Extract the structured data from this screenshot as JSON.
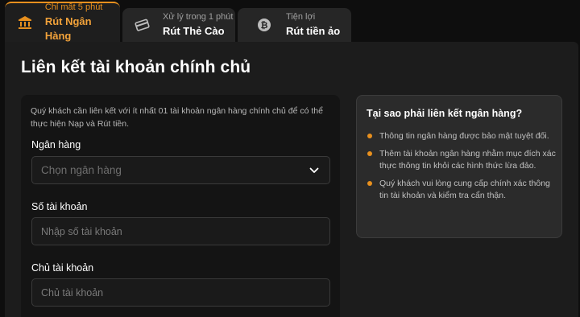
{
  "tabs": [
    {
      "sub": "Chỉ mất 5 phút",
      "main": "Rút Ngân Hàng",
      "icon": "bank-icon",
      "active": true
    },
    {
      "sub": "Xử lý trong 1 phút",
      "main": "Rút Thẻ Cào",
      "icon": "card-icon",
      "active": false
    },
    {
      "sub": "Tiện lợi",
      "main": "Rút tiền ảo",
      "icon": "bitcoin-icon",
      "active": false
    }
  ],
  "page_title": "Liên kết tài khoản chính chủ",
  "form": {
    "intro": "Quý khách cần liên kết với ít nhất 01 tài khoản ngân hàng chính chủ để có thể thực hiện Nạp và Rút tiền.",
    "bank_label": "Ngân hàng",
    "bank_placeholder": "Chọn ngân hàng",
    "account_number_label": "Số tài khoản",
    "account_number_placeholder": "Nhập số tài khoản",
    "account_holder_label": "Chủ tài khoản",
    "account_holder_placeholder": "Chủ tài khoản"
  },
  "why": {
    "title": "Tại sao phải liên kết ngân hàng?",
    "items": [
      "Thông tin ngân hàng được bảo mật tuyệt đối.",
      "Thêm tài khoản ngân hàng nhằm mục đích xác thực thông tin khỏi các hình thức lừa đảo.",
      "Quý khách vui lòng cung cấp chính xác thông tin tài khoản và kiểm tra cẩn thận."
    ]
  },
  "colors": {
    "accent": "#e8901e",
    "background": "#0e0e0e",
    "panel": "#1c1c1c"
  }
}
